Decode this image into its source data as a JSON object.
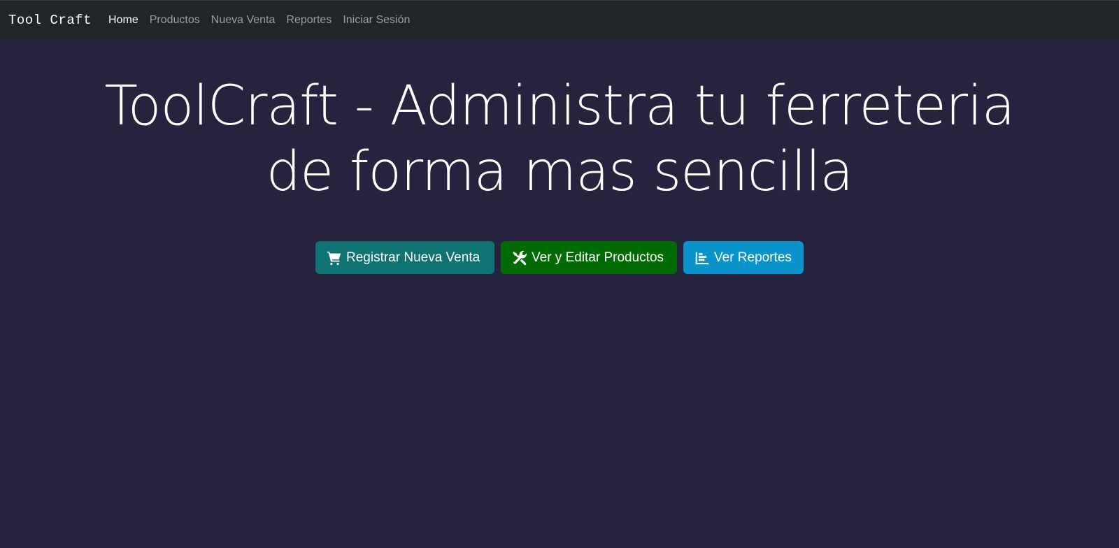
{
  "navbar": {
    "brand": "Tool Craft",
    "links": [
      {
        "label": "Home",
        "active": true
      },
      {
        "label": "Productos",
        "active": false
      },
      {
        "label": "Nueva Venta",
        "active": false
      },
      {
        "label": "Reportes",
        "active": false
      },
      {
        "label": "Iniciar Sesión",
        "active": false
      }
    ]
  },
  "hero": {
    "title": "ToolCraft - Administra tu ferreteria de forma mas sencilla"
  },
  "actions": [
    {
      "label": "Registrar Nueva Venta",
      "icon": "shopping-cart-icon",
      "color": "#0f7373"
    },
    {
      "label": "Ver y Editar Productos",
      "icon": "tools-icon",
      "color": "#036b03"
    },
    {
      "label": "Ver Reportes",
      "icon": "chart-bar-icon",
      "color": "#0b94cc"
    }
  ],
  "colors": {
    "page_background": "#25233d",
    "navbar_background": "#212529",
    "nav_link": "#9a9da2",
    "nav_link_active": "#ffffff"
  }
}
